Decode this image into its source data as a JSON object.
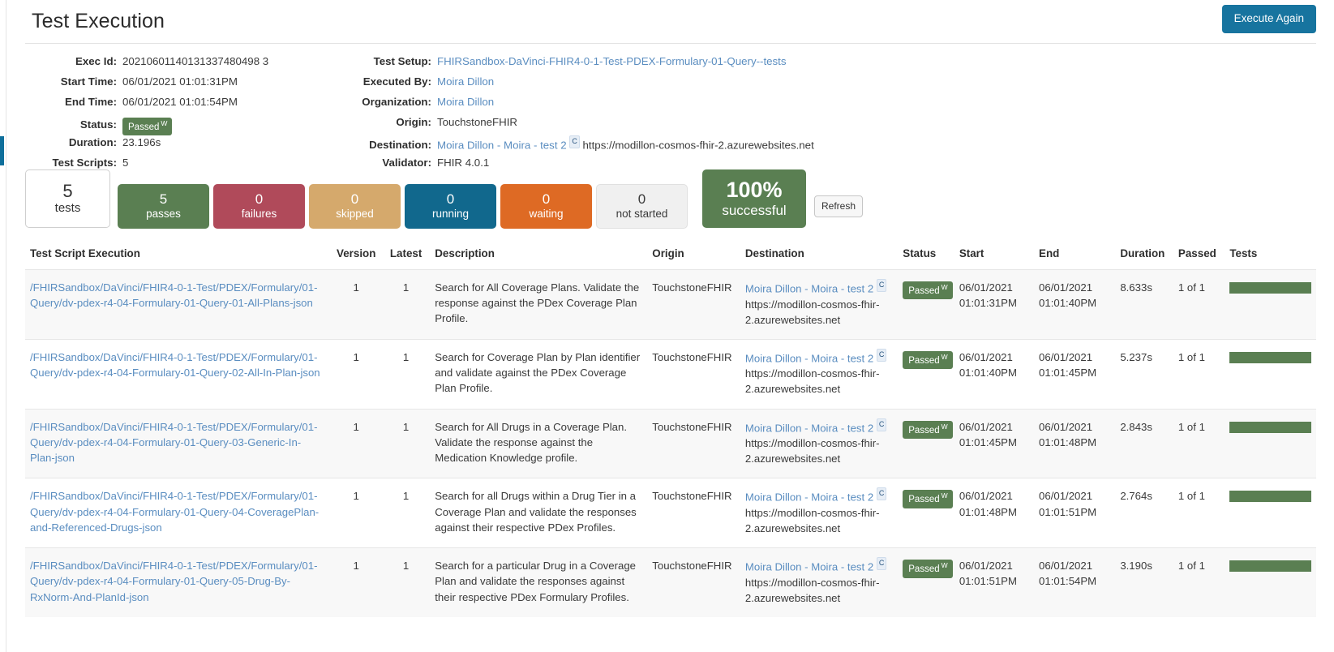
{
  "header": {
    "title": "Test Execution",
    "execute_again_label": "Execute Again"
  },
  "details": {
    "left": [
      {
        "label": "Exec Id:",
        "value": "20210601140131337480498 3",
        "type": "text"
      },
      {
        "label": "Start Time:",
        "value": "06/01/2021 01:01:31PM",
        "type": "text"
      },
      {
        "label": "End Time:",
        "value": "06/01/2021 01:01:54PM",
        "type": "text"
      },
      {
        "label": "Status:",
        "value": "Passed",
        "type": "badge",
        "sup": "W"
      },
      {
        "label": "Duration:",
        "value": "23.196s",
        "type": "text"
      },
      {
        "label": "Test Scripts:",
        "value": "5",
        "type": "text"
      }
    ],
    "exec_id": "20210601140131337480498 3",
    "right": [
      {
        "label": "Test Setup:",
        "value": "FHIRSandbox-DaVinci-FHIR4-0-1-Test-PDEX-Formulary-01-Query--tests",
        "type": "link"
      },
      {
        "label": "Executed By:",
        "value": "Moira Dillon",
        "type": "link"
      },
      {
        "label": "Organization:",
        "value": "Moira Dillon",
        "type": "link"
      },
      {
        "label": "Origin:",
        "value": "TouchstoneFHIR",
        "type": "text"
      },
      {
        "label": "Destination:",
        "value": "Moira Dillon - Moira - test 2",
        "type": "dest",
        "chip": "C",
        "url": "https://modillon-cosmos-fhir-2.azurewebsites.net"
      },
      {
        "label": "Validator:",
        "value": "FHIR 4.0.1",
        "type": "text"
      }
    ]
  },
  "stats": {
    "boxes": [
      {
        "key": "tests",
        "num": "5",
        "label": "tests"
      },
      {
        "key": "passes",
        "num": "5",
        "label": "passes"
      },
      {
        "key": "failures",
        "num": "0",
        "label": "failures"
      },
      {
        "key": "skipped",
        "num": "0",
        "label": "skipped"
      },
      {
        "key": "running",
        "num": "0",
        "label": "running"
      },
      {
        "key": "waiting",
        "num": "0",
        "label": "waiting"
      },
      {
        "key": "notstarted",
        "num": "0",
        "label": "not started"
      },
      {
        "key": "pct",
        "num": "100%",
        "label": "successful"
      }
    ],
    "refresh_label": "Refresh"
  },
  "table": {
    "columns": [
      "Test Script Execution",
      "Version",
      "Latest",
      "Description",
      "Origin",
      "Destination",
      "Status",
      "Start",
      "End",
      "Duration",
      "Passed",
      "Tests"
    ],
    "rows": [
      {
        "script": "/FHIRSandbox/DaVinci/FHIR4-0-1-Test/PDEX/Formulary/01-Query/dv-pdex-r4-04-Formulary-01-Query-01-All-Plans-json",
        "version": "1",
        "latest": "1",
        "description": "Search for All Coverage Plans. Validate the response against the PDex Coverage Plan Profile.",
        "origin": "TouchstoneFHIR",
        "dest_name": "Moira Dillon - Moira - test 2",
        "dest_chip": "C",
        "dest_url": "https://modillon-cosmos-fhir-2.azurewebsites.net",
        "status": "Passed",
        "status_sup": "W",
        "start_date": "06/01/2021",
        "start_time": "01:01:31PM",
        "end_date": "06/01/2021",
        "end_time": "01:01:40PM",
        "duration": "8.633s",
        "passed": "1 of 1",
        "bar_pct": 100
      },
      {
        "script": "/FHIRSandbox/DaVinci/FHIR4-0-1-Test/PDEX/Formulary/01-Query/dv-pdex-r4-04-Formulary-01-Query-02-All-In-Plan-json",
        "version": "1",
        "latest": "1",
        "description": "Search for Coverage Plan by Plan identifier and validate against the PDex Coverage Plan Profile.",
        "origin": "TouchstoneFHIR",
        "dest_name": "Moira Dillon - Moira - test 2",
        "dest_chip": "C",
        "dest_url": "https://modillon-cosmos-fhir-2.azurewebsites.net",
        "status": "Passed",
        "status_sup": "W",
        "start_date": "06/01/2021",
        "start_time": "01:01:40PM",
        "end_date": "06/01/2021",
        "end_time": "01:01:45PM",
        "duration": "5.237s",
        "passed": "1 of 1",
        "bar_pct": 100
      },
      {
        "script": "/FHIRSandbox/DaVinci/FHIR4-0-1-Test/PDEX/Formulary/01-Query/dv-pdex-r4-04-Formulary-01-Query-03-Generic-In-Plan-json",
        "version": "1",
        "latest": "1",
        "description": "Search for All Drugs in a Coverage Plan. Validate the response against the Medication Knowledge profile.",
        "origin": "TouchstoneFHIR",
        "dest_name": "Moira Dillon - Moira - test 2",
        "dest_chip": "C",
        "dest_url": "https://modillon-cosmos-fhir-2.azurewebsites.net",
        "status": "Passed",
        "status_sup": "W",
        "start_date": "06/01/2021",
        "start_time": "01:01:45PM",
        "end_date": "06/01/2021",
        "end_time": "01:01:48PM",
        "duration": "2.843s",
        "passed": "1 of 1",
        "bar_pct": 100
      },
      {
        "script": "/FHIRSandbox/DaVinci/FHIR4-0-1-Test/PDEX/Formulary/01-Query/dv-pdex-r4-04-Formulary-01-Query-04-CoveragePlan-and-Referenced-Drugs-json",
        "version": "1",
        "latest": "1",
        "description": "Search for all Drugs within a Drug Tier in a Coverage Plan and validate the responses against their respective PDex Profiles.",
        "origin": "TouchstoneFHIR",
        "dest_name": "Moira Dillon - Moira - test 2",
        "dest_chip": "C",
        "dest_url": "https://modillon-cosmos-fhir-2.azurewebsites.net",
        "status": "Passed",
        "status_sup": "W",
        "start_date": "06/01/2021",
        "start_time": "01:01:48PM",
        "end_date": "06/01/2021",
        "end_time": "01:01:51PM",
        "duration": "2.764s",
        "passed": "1 of 1",
        "bar_pct": 100
      },
      {
        "script": "/FHIRSandbox/DaVinci/FHIR4-0-1-Test/PDEX/Formulary/01-Query/dv-pdex-r4-04-Formulary-01-Query-05-Drug-By-RxNorm-And-PlanId-json",
        "version": "1",
        "latest": "1",
        "description": "Search for a particular Drug in a Coverage Plan and validate the responses against their respective PDex Formulary Profiles.",
        "origin": "TouchstoneFHIR",
        "dest_name": "Moira Dillon - Moira - test 2",
        "dest_chip": "C",
        "dest_url": "https://modillon-cosmos-fhir-2.azurewebsites.net",
        "status": "Passed",
        "status_sup": "W",
        "start_date": "06/01/2021",
        "start_time": "01:01:51PM",
        "end_date": "06/01/2021",
        "end_time": "01:01:54PM",
        "duration": "3.190s",
        "passed": "1 of 1",
        "bar_pct": 100
      }
    ]
  },
  "colors": {
    "accent_blue": "#17749f",
    "pass_green": "#5a7f52",
    "fail_red": "#b04a5a",
    "skipped_tan": "#d5a96c",
    "running_blue": "#11688d",
    "waiting_orange": "#de6a24",
    "link_blue": "#5a8dc0"
  }
}
